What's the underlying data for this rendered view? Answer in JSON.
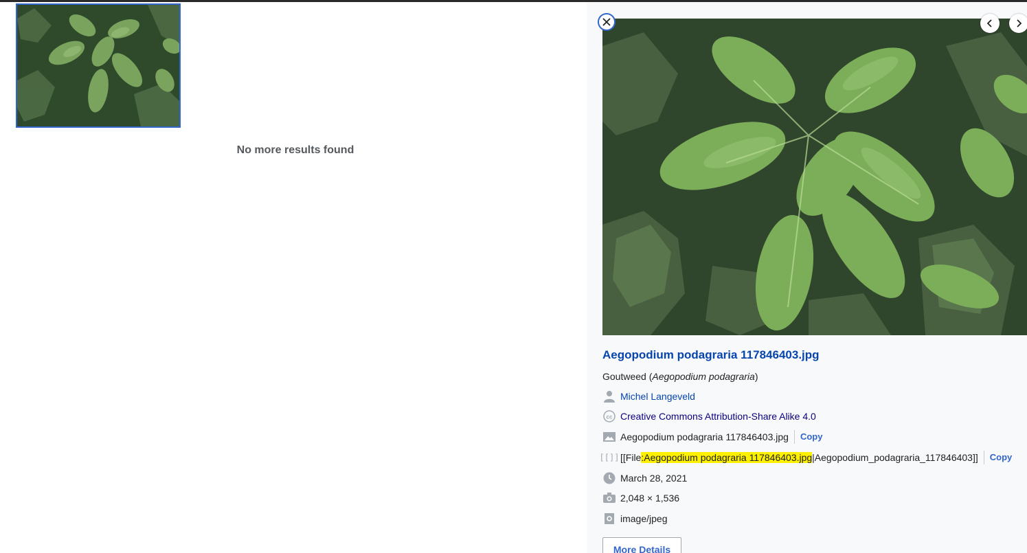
{
  "results": {
    "no_more_text": "No more results found",
    "thumbnail_alt": "Aegopodium podagraria thumbnail"
  },
  "detail": {
    "title": "Aegopodium podagraria 117846403.jpg",
    "description_prefix": "Goutweed (",
    "description_italic": "Aegopodium podagraria",
    "description_suffix": ")",
    "author": "Michel Langeveld",
    "license": "Creative Commons Attribution-Share Alike 4.0",
    "filename": "Aegopodium podagraria 117846403.jpg",
    "copy_label": "Copy",
    "wikitext_prefix": "[[File",
    "wikitext_highlight": ":Aegopodium podagraria 117846403.jpg",
    "wikitext_suffix": "|Aegopodium_podagraria_117846403]]",
    "date": "March 28, 2021",
    "dimensions": "2,048 × 1,536",
    "mime": "image/jpeg",
    "more_details": "More Details"
  },
  "icons": {
    "close": "close-icon",
    "prev": "chevron-left-icon",
    "next": "chevron-right-icon",
    "author": "user-icon",
    "license": "cc-icon",
    "file": "image-icon",
    "wikitext": "wikitext-icon",
    "date": "clock-icon",
    "dimensions": "camera-icon",
    "mime": "file-settings-icon"
  },
  "colors": {
    "link": "#0645ad",
    "accent": "#3366cc",
    "highlight": "#fef100",
    "panel_bg": "#f8f9fa"
  }
}
